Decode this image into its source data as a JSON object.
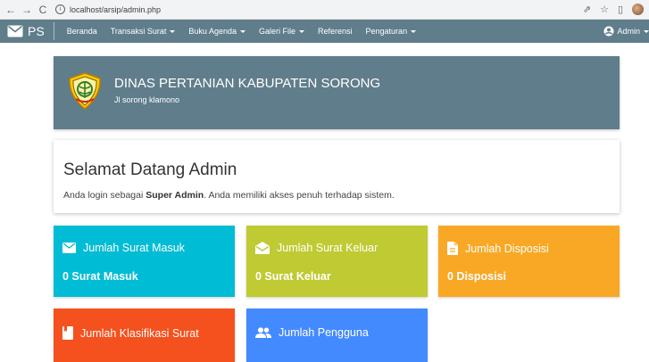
{
  "browser": {
    "url": "localhost/arsip/admin.php"
  },
  "navbar": {
    "brand": "PS",
    "menu": [
      {
        "label": "Beranda",
        "dropdown": false
      },
      {
        "label": "Transaksi Surat",
        "dropdown": true
      },
      {
        "label": "Buku Agenda",
        "dropdown": true
      },
      {
        "label": "Galeri File",
        "dropdown": true
      },
      {
        "label": "Referensi",
        "dropdown": false
      },
      {
        "label": "Pengaturan",
        "dropdown": true
      }
    ],
    "user": "Admin"
  },
  "banner": {
    "org_name": "DINAS PERTANIAN KABUPATEN SORONG",
    "address": "Jl sorong klamono"
  },
  "welcome": {
    "title": "Selamat Datang Admin",
    "text_prefix": "Anda login sebagai ",
    "role": "Super Admin",
    "text_suffix": ". Anda memiliki akses penuh terhadap sistem."
  },
  "cards": [
    {
      "title": "Jumlah Surat Masuk",
      "value": "0 Surat Masuk",
      "icon": "mail-icon",
      "color": "#00bcd4"
    },
    {
      "title": "Jumlah Surat Keluar",
      "value": "0 Surat Keluar",
      "icon": "drafts-icon",
      "color": "#c0ca33"
    },
    {
      "title": "Jumlah Disposisi",
      "value": "0 Disposisi",
      "icon": "description-icon",
      "color": "#f9a825"
    },
    {
      "title": "Jumlah Klasifikasi Surat",
      "value": "",
      "icon": "bookmark-icon",
      "color": "#f4511e"
    },
    {
      "title": "Jumlah Pengguna",
      "value": "",
      "icon": "people-icon",
      "color": "#448aff"
    }
  ],
  "colors": {
    "primary": "#607d8b"
  }
}
